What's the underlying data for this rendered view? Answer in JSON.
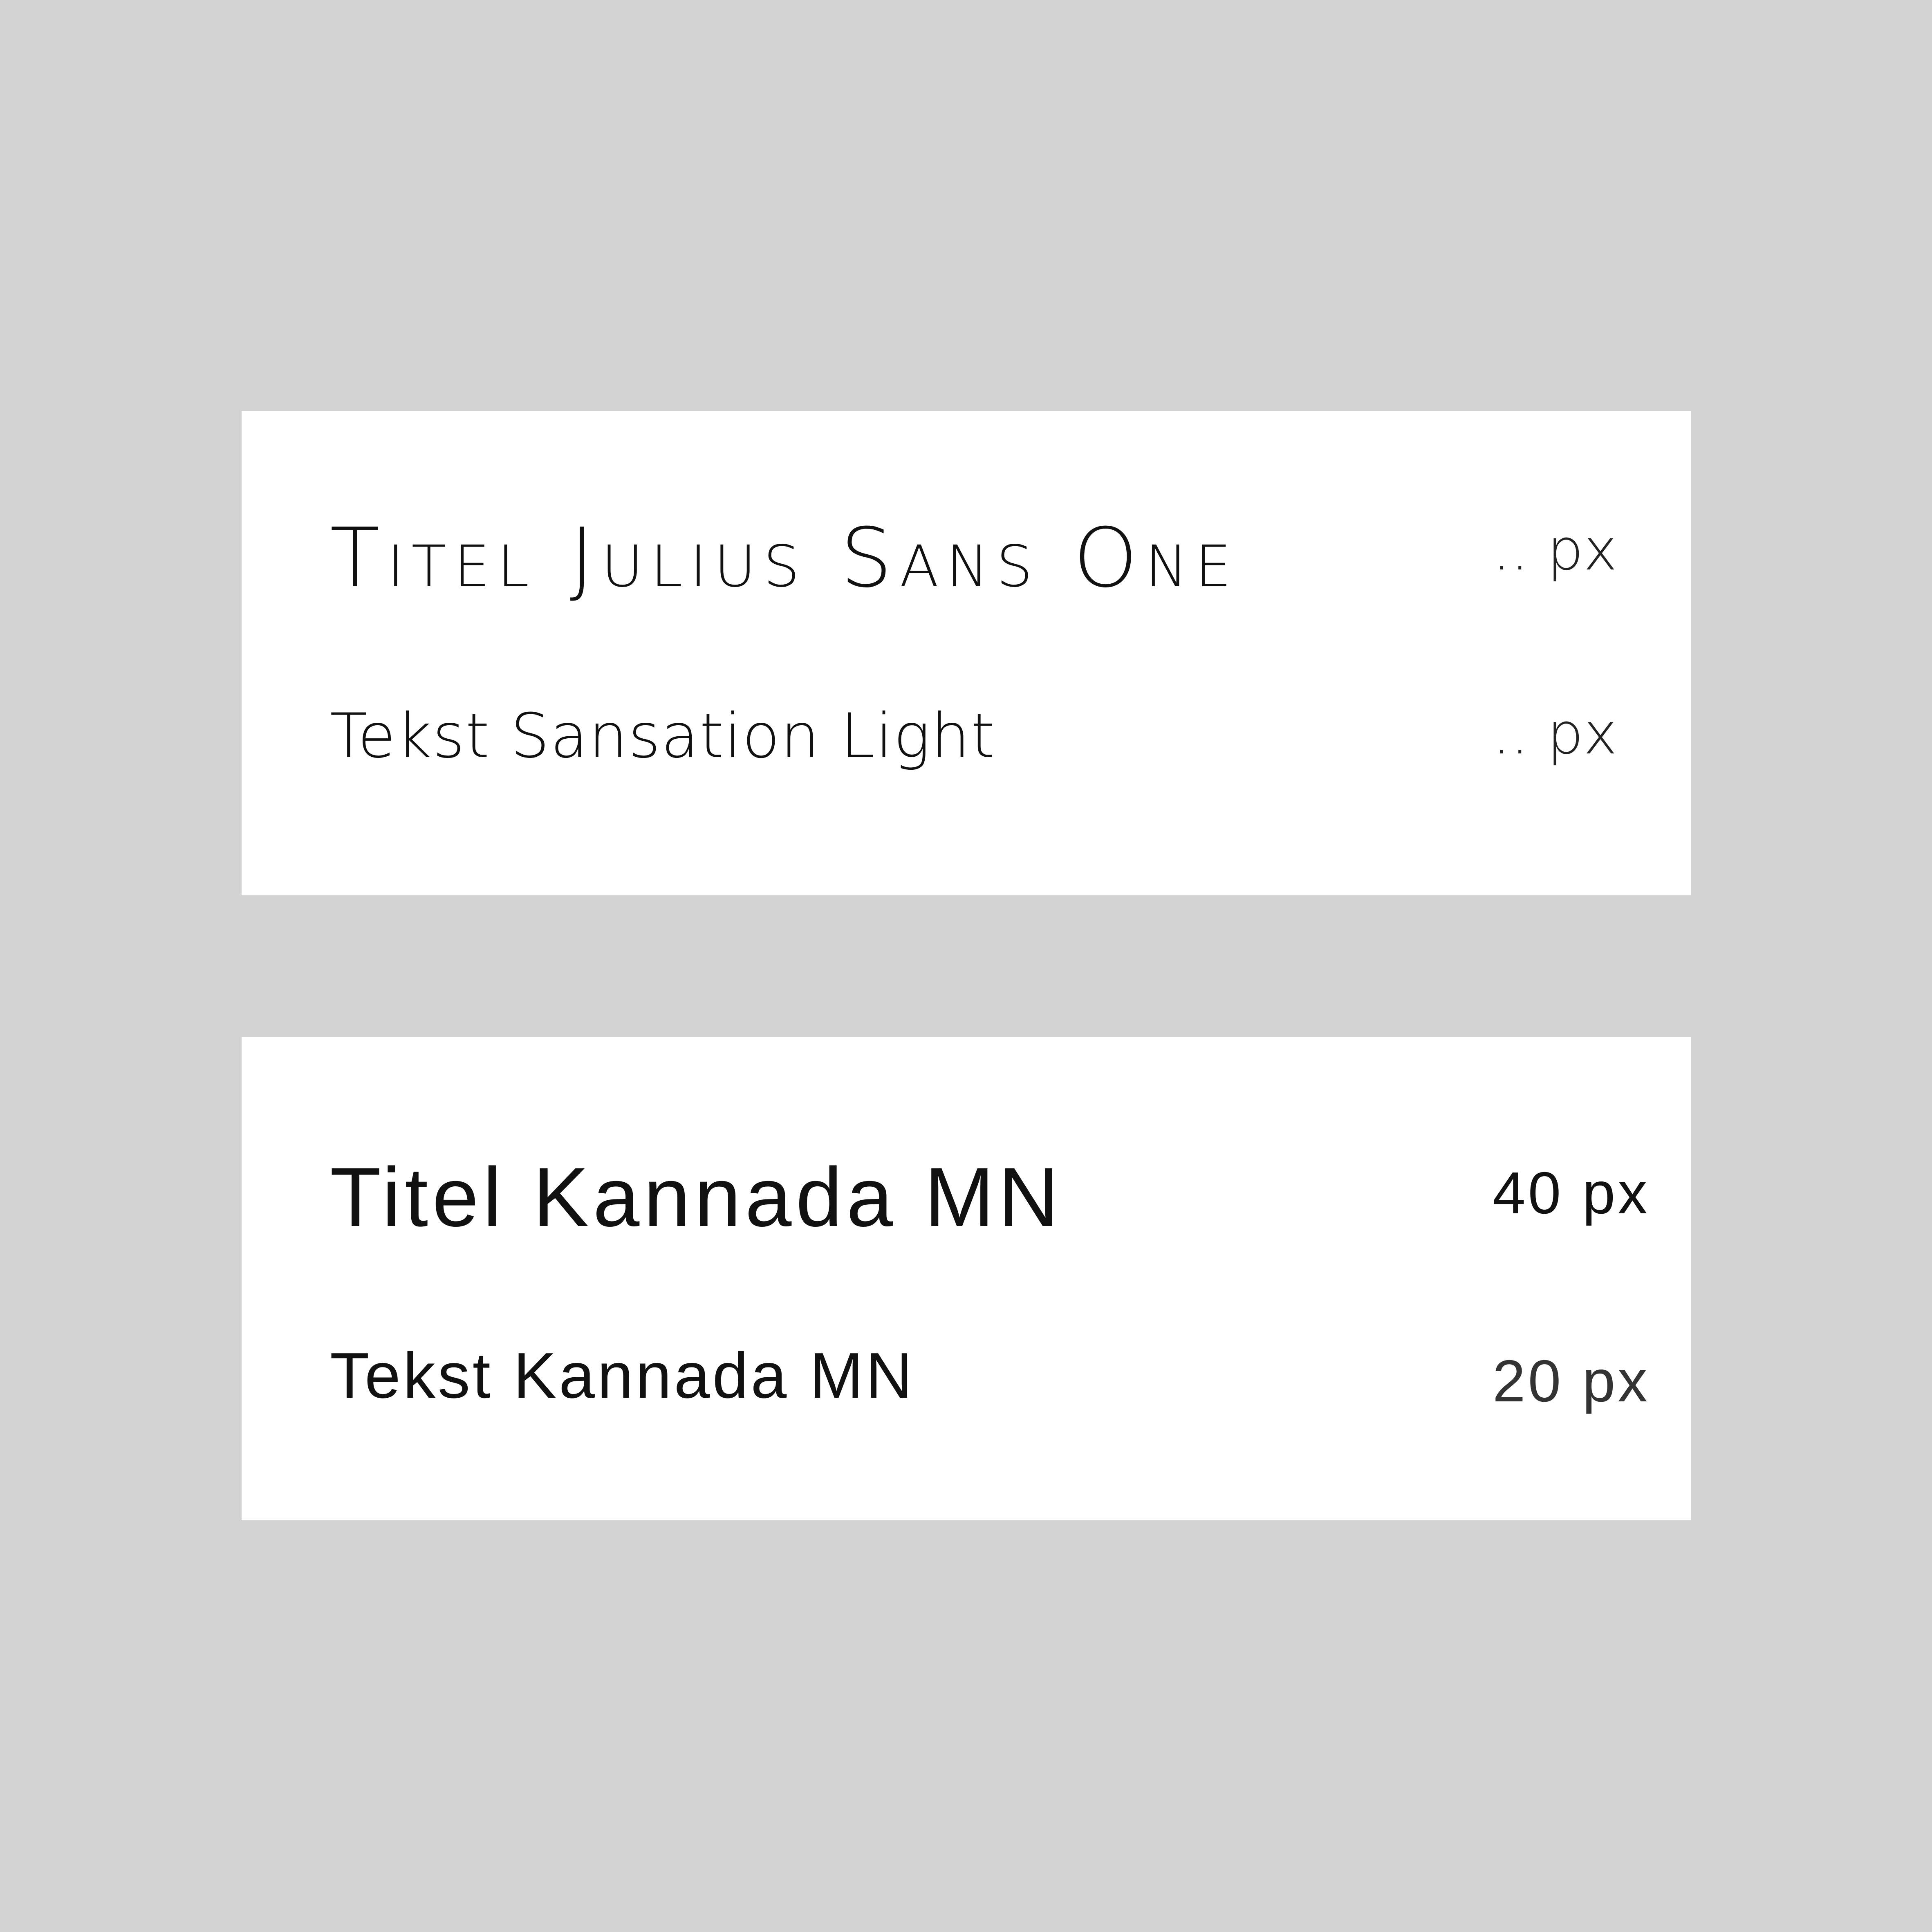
{
  "colors": {
    "background": "#d3d3d3",
    "card": "#ffffff",
    "text": "#111111"
  },
  "cards": [
    {
      "title_label": "Titel Julius Sans One",
      "title_size": ".. px",
      "text_label": "Tekst Sansation Light",
      "text_size": ".. px"
    },
    {
      "title_label": "Titel Kannada MN",
      "title_size": "40 px",
      "text_label": "Tekst Kannada MN",
      "text_size": "20 px"
    }
  ]
}
